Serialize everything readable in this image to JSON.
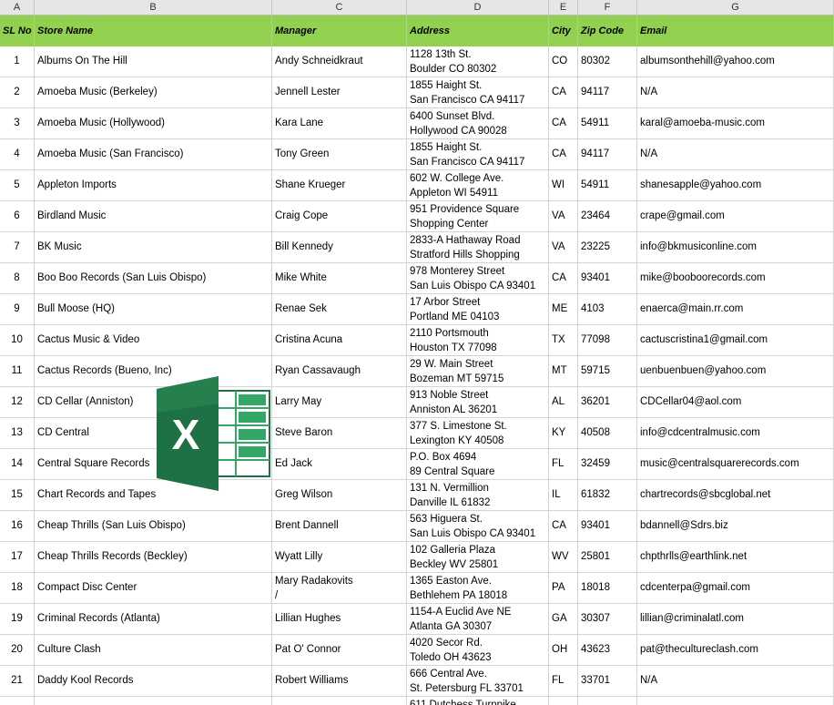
{
  "column_letters": [
    "A",
    "B",
    "C",
    "D",
    "E",
    "F",
    "G"
  ],
  "headers": {
    "sl": "SL No",
    "store": "Store Name",
    "manager": "Manager",
    "address": "Address",
    "city": "City",
    "zip": "Zip Code",
    "email": "Email"
  },
  "rows": [
    {
      "sl": "1",
      "store": "Albums On The Hill",
      "manager": "Andy Schneidkraut",
      "manager2": "",
      "addr1": "1128 13th St.",
      "addr2": "Boulder CO 80302",
      "city": "CO",
      "zip": "80302",
      "email": "albumsonthehill@yahoo.com"
    },
    {
      "sl": "2",
      "store": "Amoeba Music (Berkeley)",
      "manager": "Jennell Lester",
      "manager2": "",
      "addr1": "1855 Haight St.",
      "addr2": "San Francisco CA 94117",
      "city": "CA",
      "zip": "94117",
      "email": "N/A"
    },
    {
      "sl": "3",
      "store": "Amoeba Music (Hollywood)",
      "manager": "Kara Lane",
      "manager2": "",
      "addr1": "6400 Sunset Blvd.",
      "addr2": "Hollywood CA 90028",
      "city": "CA",
      "zip": "54911",
      "email": "karal@amoeba-music.com"
    },
    {
      "sl": "4",
      "store": "Amoeba Music (San Francisco)",
      "manager": "Tony Green",
      "manager2": "",
      "addr1": "1855 Haight St.",
      "addr2": "San Francisco CA 94117",
      "city": "CA",
      "zip": "94117",
      "email": "N/A"
    },
    {
      "sl": "5",
      "store": "Appleton Imports",
      "manager": "Shane Krueger",
      "manager2": "",
      "addr1": "602 W. College Ave.",
      "addr2": "Appleton WI 54911",
      "city": "WI",
      "zip": "54911",
      "email": "shanesapple@yahoo.com"
    },
    {
      "sl": "6",
      "store": "Birdland Music",
      "manager": "Craig Cope",
      "manager2": "",
      "addr1": "951 Providence Square",
      "addr2": "Shopping Center",
      "city": "VA",
      "zip": "23464",
      "email": "crape@gmail.com"
    },
    {
      "sl": "7",
      "store": "BK Music",
      "manager": "Bill Kennedy",
      "manager2": "",
      "addr1": "2833-A Hathaway Road",
      "addr2": "Stratford Hills Shopping",
      "city": "VA",
      "zip": "23225",
      "email": "info@bkmusiconline.com"
    },
    {
      "sl": "8",
      "store": "Boo Boo Records (San Luis Obispo)",
      "manager": "Mike White",
      "manager2": "",
      "addr1": "978 Monterey Street",
      "addr2": "San Luis Obispo CA 93401",
      "city": "CA",
      "zip": "93401",
      "email": "mike@booboorecords.com"
    },
    {
      "sl": "9",
      "store": "Bull Moose (HQ)",
      "manager": "Renae Sek",
      "manager2": "",
      "addr1": "17 Arbor Street",
      "addr2": "Portland ME 04103",
      "city": "ME",
      "zip": "4103",
      "email": "enaerca@main.rr.com"
    },
    {
      "sl": "10",
      "store": "Cactus Music & Video",
      "manager": "Cristina Acuna",
      "manager2": "",
      "addr1": "2110 Portsmouth",
      "addr2": "Houston TX 77098",
      "city": "TX",
      "zip": "77098",
      "email": "cactuscristina1@gmail.com"
    },
    {
      "sl": "11",
      "store": "Cactus Records (Bueno, Inc)",
      "manager": "Ryan Cassavaugh",
      "manager2": "",
      "addr1": "29 W. Main Street",
      "addr2": "Bozeman MT 59715",
      "city": "MT",
      "zip": "59715",
      "email": "uenbuenbuen@yahoo.com"
    },
    {
      "sl": "12",
      "store": "CD Cellar (Anniston)",
      "manager": "Larry May",
      "manager2": "",
      "addr1": "913 Noble Street",
      "addr2": "Anniston AL 36201",
      "city": "AL",
      "zip": "36201",
      "email": "CDCellar04@aol.com"
    },
    {
      "sl": "13",
      "store": "CD Central",
      "manager": "Steve Baron",
      "manager2": "",
      "addr1": "377 S. Limestone St.",
      "addr2": "Lexington KY 40508",
      "city": "KY",
      "zip": "40508",
      "email": "info@cdcentralmusic.com"
    },
    {
      "sl": "14",
      "store": "Central Square Records",
      "manager": "Ed Jack",
      "manager2": "",
      "addr1": "P.O. Box 4694",
      "addr2": "89 Central Square",
      "city": "FL",
      "zip": "32459",
      "email": "music@centralsquarerecords.com"
    },
    {
      "sl": "15",
      "store": "Chart Records and Tapes",
      "manager": "Greg Wilson",
      "manager2": "",
      "addr1": "131 N. Vermillion",
      "addr2": "Danville IL 61832",
      "city": "IL",
      "zip": "61832",
      "email": "chartrecords@sbcglobal.net"
    },
    {
      "sl": "16",
      "store": "Cheap Thrills (San Luis Obispo)",
      "manager": "Brent Dannell",
      "manager2": "",
      "addr1": "563 Higuera St.",
      "addr2": "San Luis Obispo CA 93401",
      "city": "CA",
      "zip": "93401",
      "email": "bdannell@Sdrs.biz"
    },
    {
      "sl": "17",
      "store": "Cheap Thrills Records (Beckley)",
      "manager": "Wyatt Lilly",
      "manager2": "",
      "addr1": "102 Galleria Plaza",
      "addr2": "Beckley WV 25801",
      "city": "WV",
      "zip": "25801",
      "email": "chpthrlls@earthlink.net"
    },
    {
      "sl": "18",
      "store": "Compact Disc Center",
      "manager": "Mary Radakovits",
      "manager2": "/",
      "addr1": "1365 Easton Ave.",
      "addr2": "Bethlehem PA 18018",
      "city": "PA",
      "zip": "18018",
      "email": "cdcenterpa@gmail.com"
    },
    {
      "sl": "19",
      "store": "Criminal Records (Atlanta)",
      "manager": "Lillian Hughes",
      "manager2": "",
      "addr1": "1154-A Euclid Ave NE",
      "addr2": "Atlanta GA 30307",
      "city": "GA",
      "zip": "30307",
      "email": "lillian@criminalatl.com"
    },
    {
      "sl": "20",
      "store": "Culture Clash",
      "manager": "Pat O' Connor",
      "manager2": "",
      "addr1": "4020 Secor Rd.",
      "addr2": "Toledo OH 43623",
      "city": "OH",
      "zip": "43623",
      "email": "pat@thecultureclash.com"
    },
    {
      "sl": "21",
      "store": "Daddy Kool Records",
      "manager": "Robert Williams",
      "manager2": "",
      "addr1": "666 Central Ave.",
      "addr2": "St. Petersburg FL 33701",
      "city": "FL",
      "zip": "33701",
      "email": "N/A"
    },
    {
      "sl": "",
      "store": "",
      "manager": "",
      "manager2": "",
      "addr1": "611 Dutchess Turnpike",
      "addr2": "",
      "city": "",
      "zip": "",
      "email": ""
    }
  ],
  "overlay": {
    "icon": "excel-logo-icon",
    "letter": "X",
    "colors": {
      "dark": "#1e7145",
      "mid": "#2a8a55",
      "light": "#33a866"
    }
  }
}
